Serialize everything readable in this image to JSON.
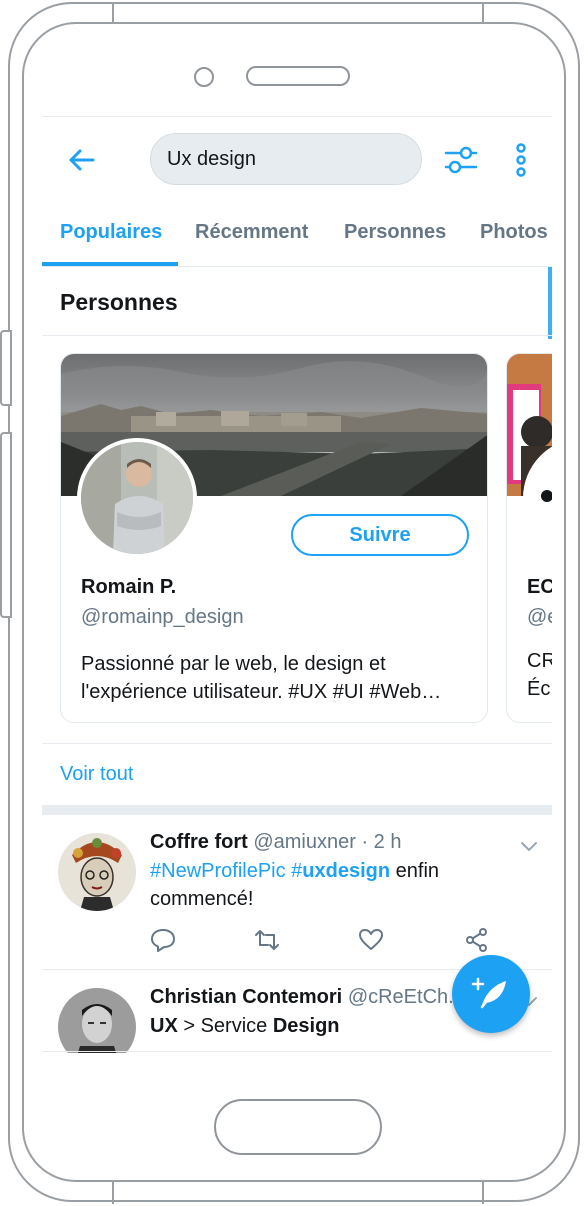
{
  "header": {
    "search_value": "Ux design"
  },
  "tabs": [
    {
      "label": "Populaires"
    },
    {
      "label": "Récemment"
    },
    {
      "label": "Personnes"
    },
    {
      "label": "Photos"
    }
  ],
  "people_section": {
    "title": "Personnes",
    "card": {
      "name": "Romain P.",
      "handle": "@romainp_design",
      "bio": "Passionné par le web, le design et l'expérience utilisateur.  #UX #UI #Web…",
      "follow_label": "Suivre"
    },
    "card2_partial": {
      "name": "EC",
      "handle": "@e",
      "bio_line1": "CR",
      "bio_line2": "Éc"
    },
    "see_all": "Voir tout"
  },
  "tweets": [
    {
      "name": "Coffre fort",
      "meta": "@amiuxner · 2 h",
      "hashtag1": "#NewProfilePic",
      "hashtag2_prefix": "#",
      "hashtag2_bold": "uxdesign",
      "text_rest": " enfin",
      "text_line2": "commencé!"
    },
    {
      "name": "Christian Contemori",
      "meta": "@cReEtCh...",
      "bold1": "UX",
      "mid": " > Service ",
      "bold2": "Design"
    }
  ],
  "colors": {
    "accent": "#1da1f2",
    "secondary_text": "#657786",
    "separator": "#e6ecf0"
  }
}
